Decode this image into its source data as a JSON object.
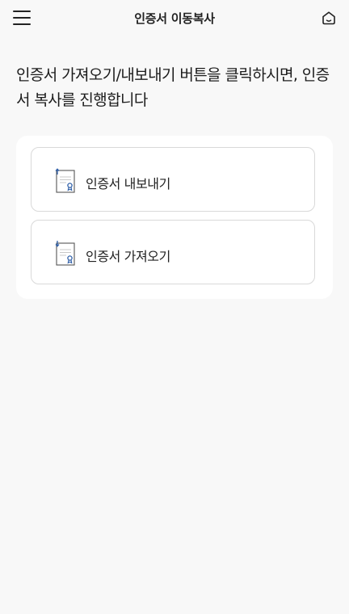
{
  "header": {
    "title": "인증서 이동복사",
    "menu_icon": "hamburger-menu-icon",
    "home_icon": "home-icon"
  },
  "description": "인증서 가져오기/내보내기 버튼을 클릭하시면, 인증서 복사를 진행합니다",
  "options": {
    "export_label": "인증서 내보내기",
    "import_label": "인증서 가져오기"
  },
  "colors": {
    "background": "#f8f8f8",
    "panel": "#ffffff",
    "card_border": "#d9d9d9",
    "icon_accent": "#2f5fa8"
  }
}
